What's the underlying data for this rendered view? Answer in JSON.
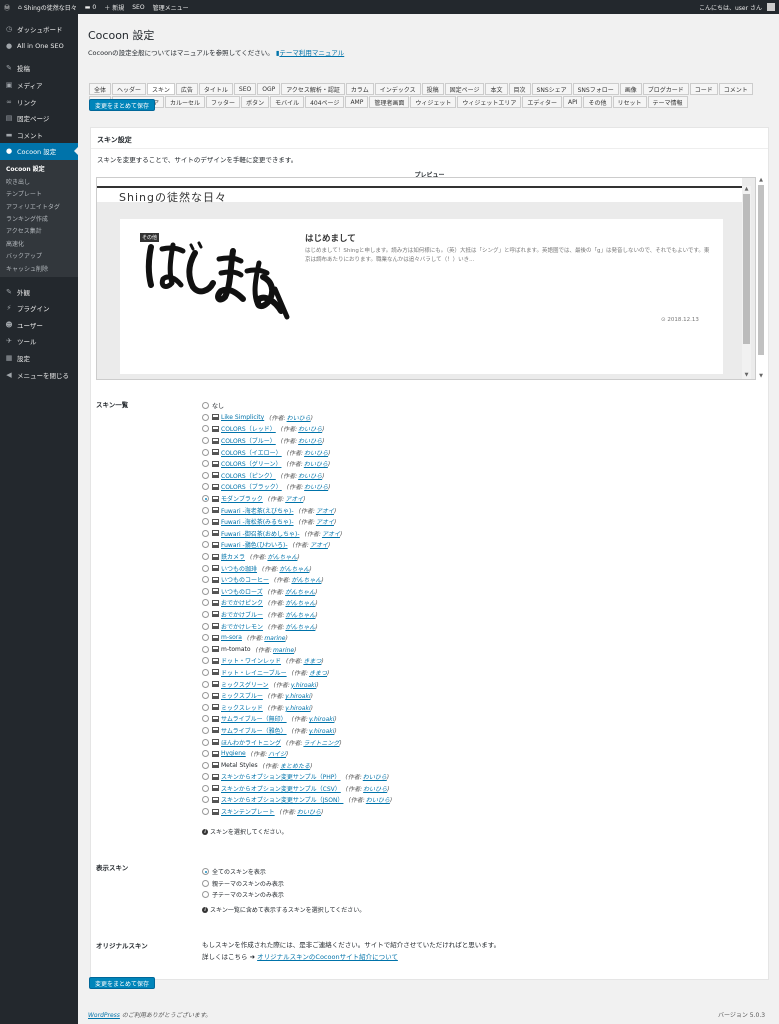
{
  "adminbar": {
    "site_name": "Shingの徒然な日々",
    "comments": "0",
    "new_label": "新規",
    "seo_label": "SEO",
    "admin_menu": "管理メニュー",
    "greeting": "こんにちは、user さん"
  },
  "sidebar": {
    "top": [
      {
        "label": "ダッシュボード",
        "icon": "dashboard-icon",
        "glyph": "◷"
      },
      {
        "label": "All in One SEO",
        "icon": "seo-icon",
        "glyph": "●"
      }
    ],
    "group2": [
      {
        "label": "投稿",
        "icon": "pin-icon",
        "glyph": "✎"
      },
      {
        "label": "メディア",
        "icon": "media-icon",
        "glyph": "▣"
      },
      {
        "label": "リンク",
        "icon": "link-icon",
        "glyph": "∞"
      },
      {
        "label": "固定ページ",
        "icon": "page-icon",
        "glyph": "▤"
      },
      {
        "label": "コメント",
        "icon": "comment-icon",
        "glyph": "▬"
      }
    ],
    "current": {
      "label": "Cocoon 設定",
      "icon": "cocoon-icon",
      "glyph": "●"
    },
    "submenu": [
      "Cocoon 設定",
      "吹き出し",
      "テンプレート",
      "アフィリエイトタグ",
      "ランキング作成",
      "アクセス集計",
      "高速化",
      "バックアップ",
      "キャッシュ削除"
    ],
    "group3": [
      {
        "label": "外観",
        "icon": "appearance-icon",
        "glyph": "✎"
      },
      {
        "label": "プラグイン",
        "icon": "plugin-icon",
        "glyph": "⚡"
      },
      {
        "label": "ユーザー",
        "icon": "user-icon",
        "glyph": "☻"
      },
      {
        "label": "ツール",
        "icon": "tool-icon",
        "glyph": "✈"
      },
      {
        "label": "設定",
        "icon": "settings-icon",
        "glyph": "▦"
      },
      {
        "label": "メニューを閉じる",
        "icon": "collapse-icon",
        "glyph": "◀"
      }
    ]
  },
  "page": {
    "title": "Cocoon 設定",
    "manual_text": "Cocoonの設定全般についてはマニュアルを参照してください。",
    "manual_link": "テーマ利用マニュアル"
  },
  "tabs": [
    "全体",
    "ヘッダー",
    "スキン",
    "広告",
    "タイトル",
    "SEO",
    "OGP",
    "アクセス解析・認証",
    "カラム",
    "インデックス",
    "投稿",
    "固定ページ",
    "本文",
    "目次",
    "SNSシェア",
    "SNSフォロー",
    "画像",
    "ブログカード",
    "コード",
    "コメント",
    "通知",
    "アピールエリア",
    "カルーセル",
    "フッター",
    "ボタン",
    "モバイル",
    "404ページ",
    "AMP",
    "管理者画面",
    "ウィジェット",
    "ウィジェットエリア",
    "エディター",
    "API",
    "その他",
    "リセット",
    "テーマ情報"
  ],
  "save_label": "変更をまとめて保存",
  "skin": {
    "section_title": "スキン設定",
    "description": "スキンを変更することで、サイトのデザインを手軽に変更できます。",
    "preview_label": "プレビュー",
    "preview": {
      "site_title": "Shingの徒然な日々",
      "category": "その他",
      "thumb_text": "はじめまして",
      "post_title": "はじめまして",
      "snippet": "はじめまして！Shingと申します。読み方は如何様にも。（英）大抵は「シング」と呼ばれます。英語圏では、最後の「g」は発音しないので、それでもよいです。東京は調布あたりにおります。職業なんかは追々バラして（！）いき...",
      "date": "2018.12.13"
    },
    "list_label": "スキン一覧",
    "author_prefix": "(作者:",
    "author_suffix": ")",
    "list": [
      {
        "name": "なし",
        "author": "",
        "link": false,
        "checked": false
      },
      {
        "name": "Like Simplicity",
        "author": "わいひら",
        "link": true,
        "checked": false
      },
      {
        "name": "COLORS（レッド）",
        "author": "わいひら",
        "link": true,
        "checked": false
      },
      {
        "name": "COLORS（ブルー）",
        "author": "わいひら",
        "link": true,
        "checked": false
      },
      {
        "name": "COLORS（イエロー）",
        "author": "わいひら",
        "link": true,
        "checked": false
      },
      {
        "name": "COLORS（グリーン）",
        "author": "わいひら",
        "link": true,
        "checked": false
      },
      {
        "name": "COLORS（ピンク）",
        "author": "わいひら",
        "link": true,
        "checked": false
      },
      {
        "name": "COLORS（ブラック）",
        "author": "わいひら",
        "link": true,
        "checked": false
      },
      {
        "name": "モダンブラック",
        "author": "アオイ",
        "link": true,
        "checked": true
      },
      {
        "name": "Fuwari -海老茶(えびちゃ)-",
        "author": "アオイ",
        "link": true,
        "checked": false
      },
      {
        "name": "Fuwari -海松茶(みるちゃ)-",
        "author": "アオイ",
        "link": true,
        "checked": false
      },
      {
        "name": "Fuwari -御召茶(おめしちゃ)-",
        "author": "アオイ",
        "link": true,
        "checked": false
      },
      {
        "name": "Fuwari -鶸色(ひわいろ)-",
        "author": "アオイ",
        "link": true,
        "checked": false
      },
      {
        "name": "鉄カメラ",
        "author": "がんちゃん",
        "link": true,
        "checked": false
      },
      {
        "name": "いつもの珈琲",
        "author": "がんちゃん",
        "link": true,
        "checked": false
      },
      {
        "name": "いつものコーヒー",
        "author": "がんちゃん",
        "link": true,
        "checked": false
      },
      {
        "name": "いつものローズ",
        "author": "がんちゃん",
        "link": true,
        "checked": false
      },
      {
        "name": "おでかけピンク",
        "author": "がんちゃん",
        "link": true,
        "checked": false
      },
      {
        "name": "おでかけブルー",
        "author": "がんちゃん",
        "link": true,
        "checked": false
      },
      {
        "name": "おでかけレモン",
        "author": "がんちゃん",
        "link": true,
        "checked": false
      },
      {
        "name": "m-sora",
        "author": "marine",
        "link": true,
        "checked": false
      },
      {
        "name": "m-tomato",
        "author": "marine",
        "link": false,
        "checked": false
      },
      {
        "name": "ドット・ワインレッド",
        "author": "きまつ",
        "link": true,
        "checked": false
      },
      {
        "name": "ドット・レイニーブルー",
        "author": "きまつ",
        "link": true,
        "checked": false
      },
      {
        "name": "ミックスグリーン",
        "author": "y.hiroaki",
        "link": true,
        "checked": false
      },
      {
        "name": "ミックスブルー",
        "author": "y.hiroaki",
        "link": true,
        "checked": false
      },
      {
        "name": "ミックスレッド",
        "author": "y.hiroaki",
        "link": true,
        "checked": false
      },
      {
        "name": "サムライブルー（無印）",
        "author": "y.hiroaki",
        "link": true,
        "checked": false
      },
      {
        "name": "サムライブルー（雅色）",
        "author": "y.hiroaki",
        "link": true,
        "checked": false
      },
      {
        "name": "ほんわかライトニング",
        "author": "ライトニング",
        "link": true,
        "checked": false
      },
      {
        "name": "Hygiene",
        "author": "ハイジ",
        "link": true,
        "checked": false
      },
      {
        "name": "Metal Styles",
        "author": "まとめたる",
        "link": false,
        "checked": false
      },
      {
        "name": "スキンからオプション変更サンプル（PHP）",
        "author": "わいひら",
        "link": true,
        "checked": false
      },
      {
        "name": "スキンからオプション変更サンプル（CSV）",
        "author": "わいひら",
        "link": true,
        "checked": false
      },
      {
        "name": "スキンからオプション変更サンプル（JSON）",
        "author": "わいひら",
        "link": true,
        "checked": false
      },
      {
        "name": "スキンテンプレート",
        "author": "わいひら",
        "link": true,
        "checked": false
      }
    ],
    "list_hint": "スキンを選択してください。",
    "display_label": "表示スキン",
    "display_options": [
      {
        "label": "全てのスキンを表示",
        "checked": true
      },
      {
        "label": "親テーマのスキンのみ表示",
        "checked": false
      },
      {
        "label": "子テーマのスキンのみ表示",
        "checked": false
      }
    ],
    "display_hint": "スキン一覧に含めて表示するスキンを選択してください。",
    "original_label": "オリジナルスキン",
    "original_text": "もしスキンを作成された際には、是非ご連絡ください。サイトで紹介させていただければと思います。",
    "original_prefix": "詳しくはこちら",
    "original_link": "オリジナルスキンのCocoonサイト紹介について"
  },
  "footer": {
    "wp_link": "WordPress",
    "thanks": " のご利用ありがとうございます。",
    "version": "バージョン 5.0.3"
  },
  "colors": {
    "accent": "#0073aa",
    "button": "#0085ba",
    "sidebar": "#23282d"
  }
}
